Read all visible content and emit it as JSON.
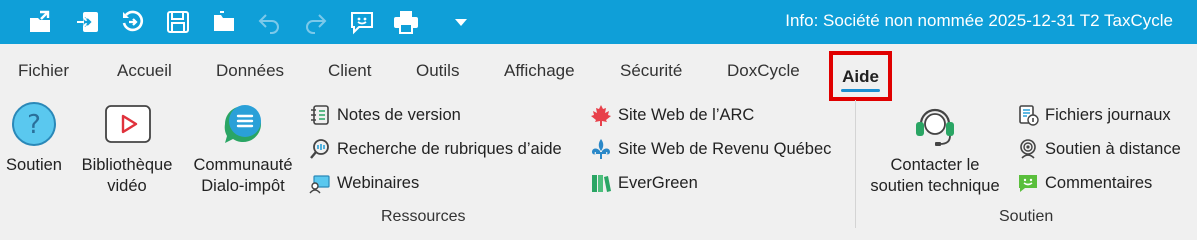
{
  "title_bar": {
    "title": "Info: Société non nommée 2025-12-31 T2 TaxCycle",
    "quick_access": [
      {
        "name": "new-file-icon"
      },
      {
        "name": "import-icon"
      },
      {
        "name": "rollforward-icon"
      },
      {
        "name": "save-icon"
      },
      {
        "name": "open-folder-icon"
      },
      {
        "name": "undo-icon"
      },
      {
        "name": "redo-icon"
      },
      {
        "name": "feedback-icon"
      },
      {
        "name": "print-icon"
      },
      {
        "name": "customize-dropdown-icon"
      }
    ]
  },
  "tabs": {
    "fichier": "Fichier",
    "accueil": "Accueil",
    "donnees": "Données",
    "client": "Client",
    "outils": "Outils",
    "affichage": "Affichage",
    "securite": "Sécurité",
    "doxcycle": "DoxCycle",
    "aide": "Aide"
  },
  "ribbon": {
    "ressources": {
      "label": "Ressources",
      "soutien": "Soutien",
      "bibliotheque": "Bibliothèque\nvidéo",
      "communaute": "Communauté\nDialo-impôt",
      "notes": "Notes de version",
      "recherche": "Recherche de rubriques d’aide",
      "webinaires": "Webinaires",
      "site_arc": "Site Web de l’ARC",
      "site_rq": "Site Web de Revenu Québec",
      "evergreen": "EverGreen"
    },
    "soutien": {
      "label": "Soutien",
      "contacter": "Contacter le\nsoutien technique",
      "fichiers": "Fichiers journaux",
      "distance": "Soutien à distance",
      "commentaires": "Commentaires"
    }
  },
  "colors": {
    "title_bar": "#0f9fd8",
    "accent": "#1a8fd1",
    "highlight_box": "#e00000"
  }
}
